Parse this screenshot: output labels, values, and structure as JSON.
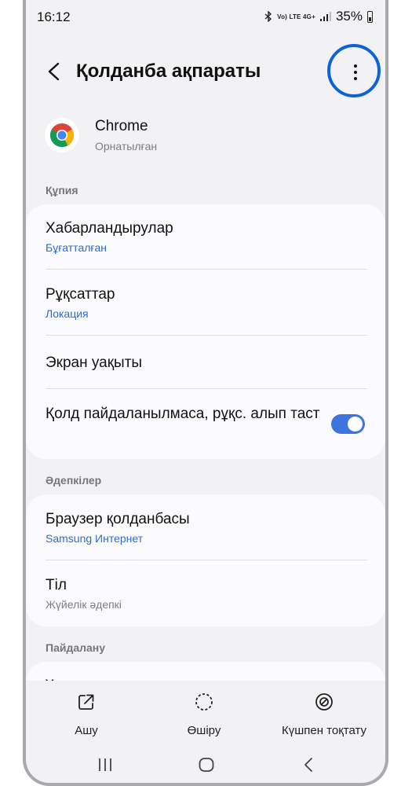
{
  "status_bar": {
    "time": "16:12",
    "signal_labels": "Vo) LTE 4G+",
    "battery_percent": "35%"
  },
  "header": {
    "title": "Қолданба ақпараты"
  },
  "app": {
    "name": "Chrome",
    "status": "Орнатылған"
  },
  "sections": {
    "privacy": {
      "label": "Құпия",
      "items": [
        {
          "title": "Хабарландырулар",
          "subtitle": "Бұғатталған"
        },
        {
          "title": "Рұқсаттар",
          "subtitle": "Локация"
        },
        {
          "title": "Экран уақыты"
        },
        {
          "title": "Қолд пайдаланылмаса, рұқс. алып таст",
          "toggle_on": true
        }
      ]
    },
    "defaults": {
      "label": "Әдепкілер",
      "items": [
        {
          "title": "Браузер қолданбасы",
          "subtitle": "Samsung Интернет"
        },
        {
          "title": "Тіл",
          "subtitle": "Жүйелік әдепкі"
        }
      ]
    },
    "usage": {
      "label": "Пайдалану",
      "items": [
        {
          "title": "Ұялы деректер"
        }
      ]
    }
  },
  "bottom_actions": [
    {
      "label": "Ашу",
      "icon": "open-external-icon"
    },
    {
      "label": "Өшіру",
      "icon": "disable-icon"
    },
    {
      "label": "Күшпен тоқтату",
      "icon": "force-stop-icon"
    }
  ],
  "colors": {
    "accent": "#3d74de",
    "link": "#2a6bd0",
    "highlight": "#0b63d6",
    "background": "#f2f2f4"
  }
}
